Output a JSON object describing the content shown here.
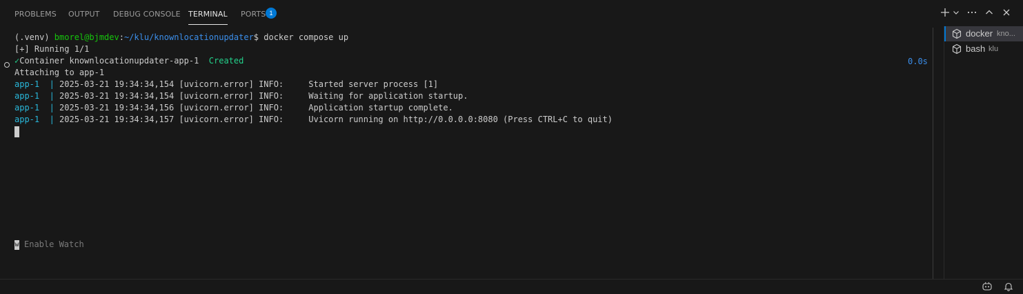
{
  "tabs": [
    {
      "label": "PROBLEMS"
    },
    {
      "label": "OUTPUT"
    },
    {
      "label": "DEBUG CONSOLE"
    },
    {
      "label": "TERMINAL"
    },
    {
      "label": "PORTS",
      "badge": "1"
    }
  ],
  "actions": [
    "new-terminal-icon",
    "chevron-down-icon",
    "more-icon",
    "maximize-panel-icon",
    "close-icon"
  ],
  "terminal": {
    "prompt": {
      "venv": "(.venv) ",
      "user_host": "bmorel@bjmdev",
      "colon": ":",
      "path": "~/klu/knownlocationupdater",
      "dollar": "$ ",
      "command": "docker compose up"
    },
    "running": "[+] Running 1/1",
    "container": {
      "check": "✓",
      "text": "Container knownlocationupdater-app-1",
      "status": "Created",
      "time": "0.0s"
    },
    "attaching": "Attaching to app-1",
    "logs": [
      {
        "prefix": "app-1",
        "sep": "|",
        "text": "2025-03-21 19:34:34,154 [uvicorn.error] INFO:     Started server process [1]"
      },
      {
        "prefix": "app-1",
        "sep": "|",
        "text": "2025-03-21 19:34:34,154 [uvicorn.error] INFO:     Waiting for application startup."
      },
      {
        "prefix": "app-1",
        "sep": "|",
        "text": "2025-03-21 19:34:34,156 [uvicorn.error] INFO:     Application startup complete."
      },
      {
        "prefix": "app-1",
        "sep": "|",
        "text": "2025-03-21 19:34:34,157 [uvicorn.error] INFO:     Uvicorn running on http://0.0.0.0:8080 (Press CTRL+C to quit)"
      }
    ],
    "watch_key": "w",
    "watch_label": "Enable Watch"
  },
  "terminal_list": [
    {
      "name": "docker",
      "desc": "kno...",
      "icon": "terminal-box-icon",
      "active": true
    },
    {
      "name": "bash",
      "desc": "klu",
      "icon": "terminal-box-icon",
      "active": false
    }
  ],
  "colors": {
    "background": "#181818",
    "text": "#cccccc",
    "green": "#23d18b",
    "blue": "#3b8eea",
    "cyan": "#29b8db",
    "accent": "#0078d4"
  }
}
